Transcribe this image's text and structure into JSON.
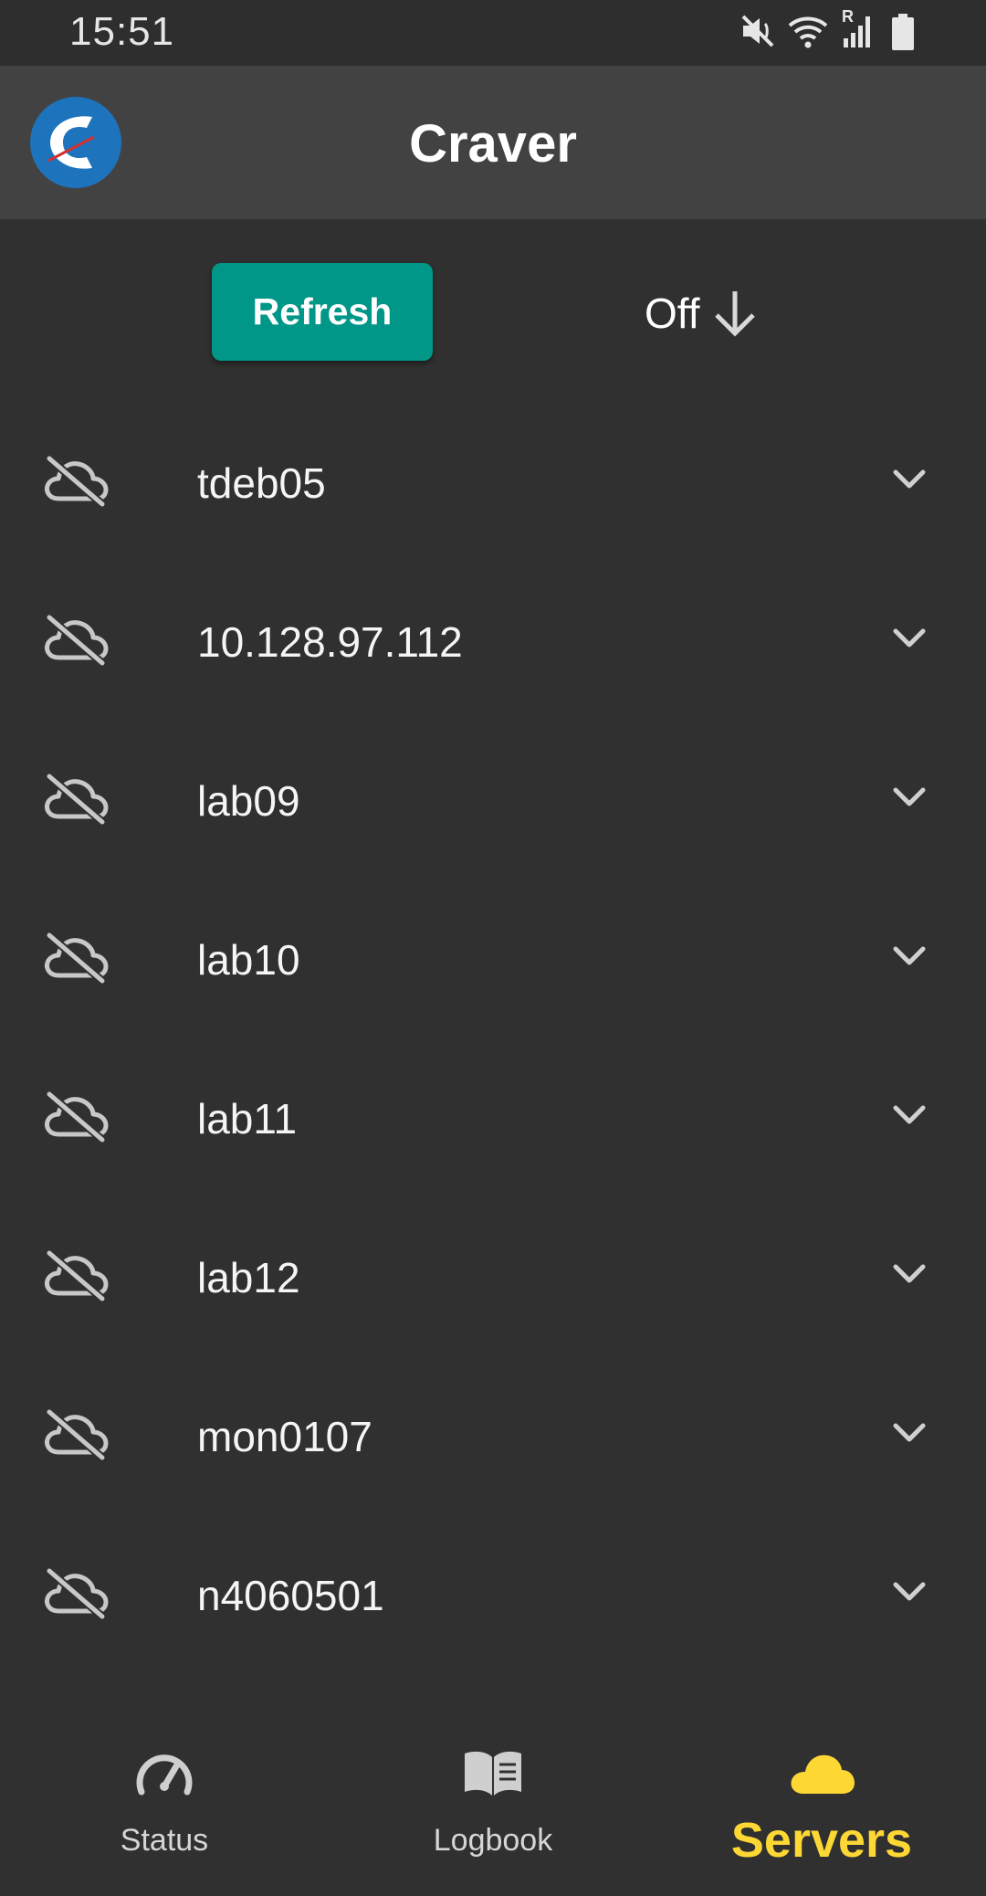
{
  "status_bar": {
    "time": "15:51",
    "icons": [
      "mute-icon",
      "wifi-icon",
      "signal-icon",
      "battery-icon"
    ],
    "roaming_letter": "R"
  },
  "app_bar": {
    "title": "Craver",
    "logo_icon": "craver-logo-icon"
  },
  "controls": {
    "refresh_label": "Refresh",
    "sort_label": "Off",
    "sort_icon": "arrow-down-icon"
  },
  "servers": [
    {
      "name": "tdeb05",
      "status_icon": "cloud-off-icon"
    },
    {
      "name": "10.128.97.112",
      "status_icon": "cloud-off-icon"
    },
    {
      "name": "lab09",
      "status_icon": "cloud-off-icon"
    },
    {
      "name": "lab10",
      "status_icon": "cloud-off-icon"
    },
    {
      "name": "lab11",
      "status_icon": "cloud-off-icon"
    },
    {
      "name": "lab12",
      "status_icon": "cloud-off-icon"
    },
    {
      "name": "mon0107",
      "status_icon": "cloud-off-icon"
    },
    {
      "name": "n4060501",
      "status_icon": "cloud-off-icon"
    }
  ],
  "bottom_nav": {
    "items": [
      {
        "label": "Status",
        "icon": "speedometer-icon",
        "active": false
      },
      {
        "label": "Logbook",
        "icon": "book-icon",
        "active": false
      },
      {
        "label": "Servers",
        "icon": "cloud-icon",
        "active": true
      }
    ]
  },
  "colors": {
    "background": "#303030",
    "app_bar": "#424242",
    "accent": "#009688",
    "active_nav": "#fdd835"
  }
}
